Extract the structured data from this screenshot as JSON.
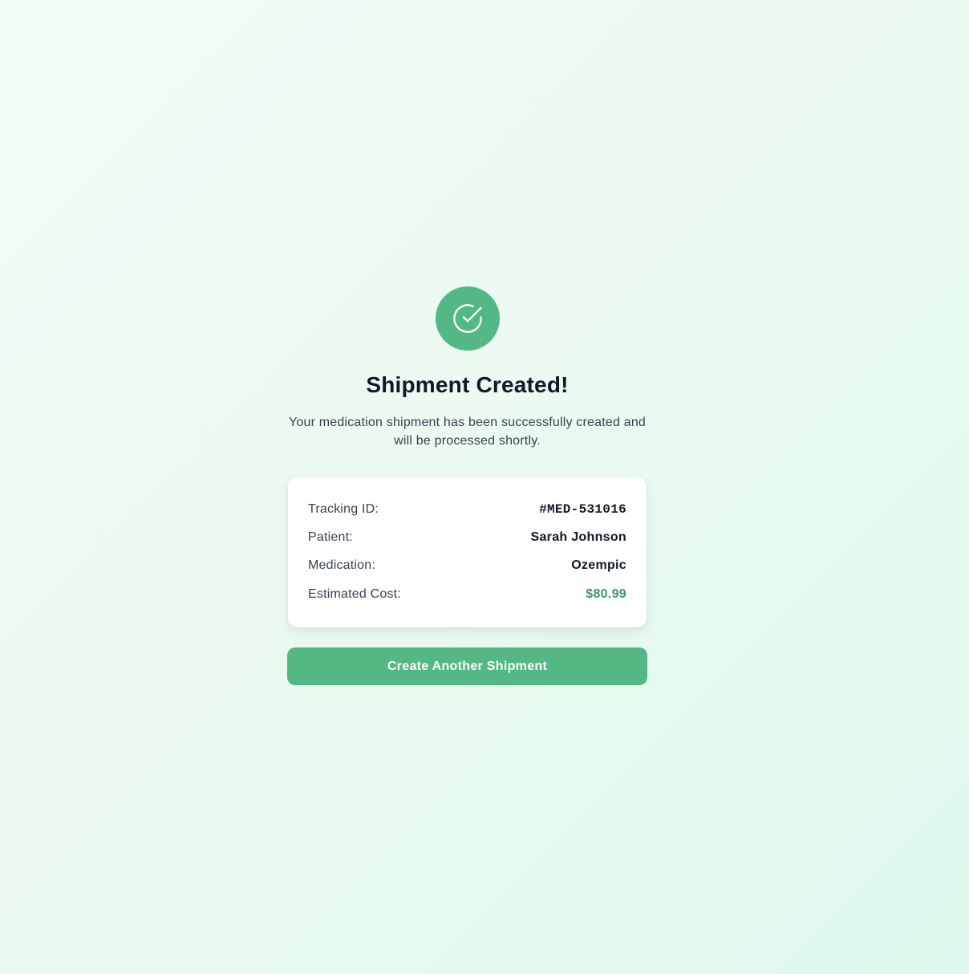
{
  "status_icon": "check-circle-icon",
  "heading": "Shipment Created!",
  "message": "Your medication shipment has been successfully created and will be processed shortly.",
  "details": {
    "tracking_label": "Tracking ID:",
    "tracking_value": "#MED-531016",
    "patient_label": "Patient:",
    "patient_value": "Sarah Johnson",
    "medication_label": "Medication:",
    "medication_value": "Ozempic",
    "cost_label": "Estimated Cost:",
    "cost_value": "$80.99"
  },
  "actions": {
    "create_another_label": "Create Another Shipment"
  },
  "colors": {
    "accent": "#54b885",
    "cost_text": "#3a9866",
    "background_start": "#f1fcf5",
    "background_end": "#def9ed"
  }
}
